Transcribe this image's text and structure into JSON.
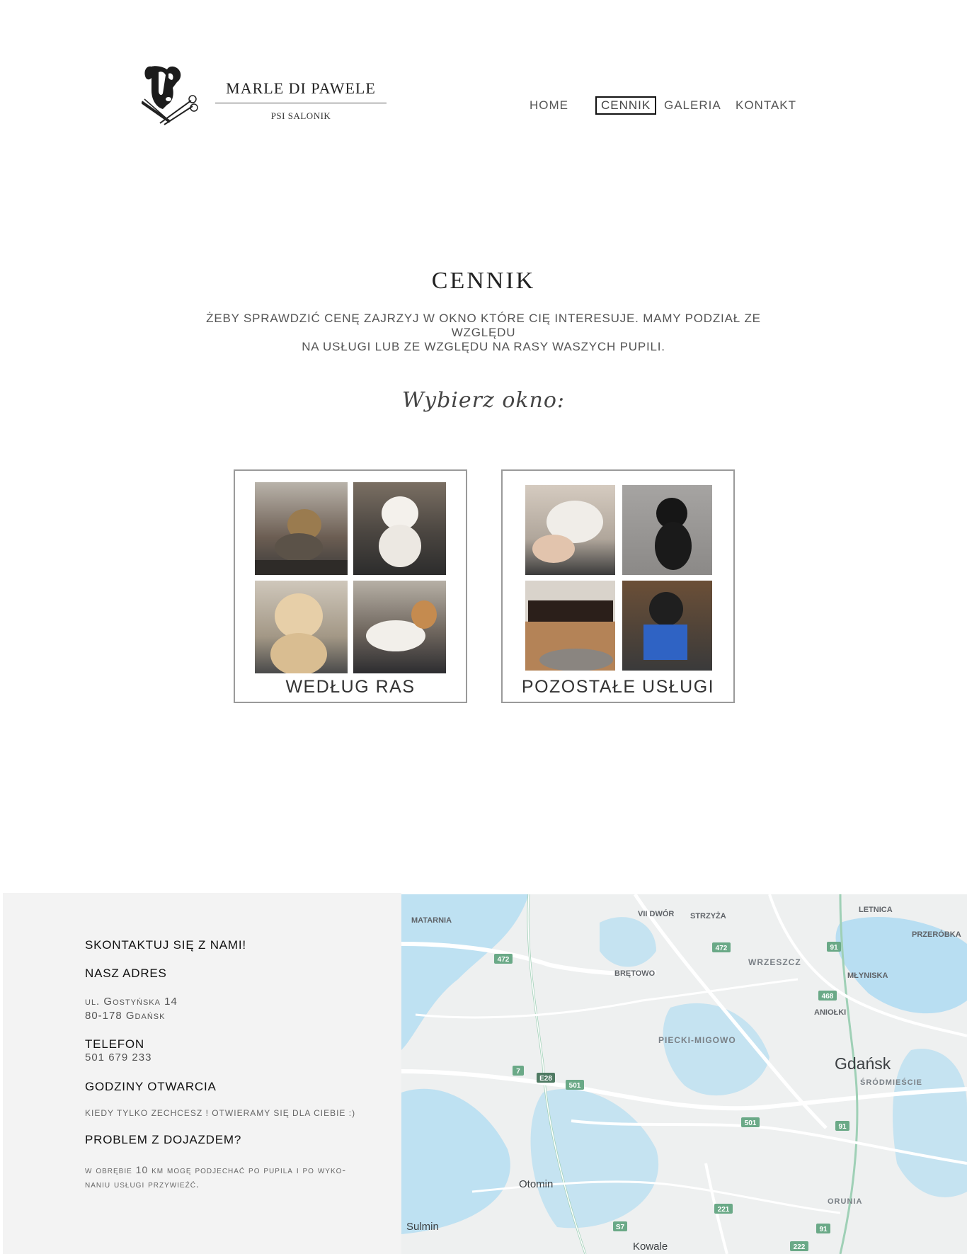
{
  "header": {
    "brand_title": "MARLE DI PAWELE",
    "brand_subtitle": "PSI SALONIK",
    "nav": [
      {
        "label": "HOME",
        "active": false
      },
      {
        "label": "CENNIK",
        "active": true
      },
      {
        "label": "GALERIA",
        "active": false
      },
      {
        "label": "KONTAKT",
        "active": false
      }
    ]
  },
  "main": {
    "title": "CENNIK",
    "intro_line1": "ŻEBY SPRAWDZIĆ CENĘ ZAJRZYJ W OKNO KTÓRE CIĘ INTERESUJE. MAMY PODZIAŁ ZE WZGLĘDU",
    "intro_line2": "NA USŁUGI LUB ZE WZGLĘDU NA RASY WASZYCH PUPILI.",
    "choose_label": "Wybierz okno:",
    "cards": [
      {
        "label": "WEDŁUG RAS"
      },
      {
        "label": "POZOSTAŁE USŁUGI"
      }
    ]
  },
  "footer": {
    "contact_heading": "SKONTAKTUJ SIĘ Z NAMI!",
    "address_heading": "NASZ ADRES",
    "address_line1": "ul. Gostyńska 14",
    "address_line2": "80-178 Gdańsk",
    "phone_heading": "TELEFON",
    "phone": "501 679 233",
    "hours_heading": "GODZINY OTWARCIA",
    "hours_text": "KIEDY TYLKO ZECHCESZ ! OTWIERAMY SIĘ DLA CIEBIE :)",
    "travel_heading": "PROBLEM Z DOJAZDEM?",
    "travel_line1": "w obrębie 10 km mogę podjechać po pupila i po wyko-",
    "travel_line2": "naniu usługi przywieźć."
  },
  "map": {
    "places": [
      "MATARNIA",
      "VII DWÓR",
      "STRZYŻA",
      "LETNICA",
      "PRZERÓBKA",
      "BRĘTOWO",
      "WRZESZCZ",
      "MŁYNISKA",
      "ANIOŁKI",
      "PIECKI-MIGOWO",
      "Gdańsk",
      "ŚRÓDMIEŚCIE",
      "Otomin",
      "ORUNIA",
      "Sulmin",
      "Kowale"
    ],
    "roads": [
      "472",
      "472",
      "91",
      "468",
      "7",
      "E28",
      "501",
      "501",
      "91",
      "221",
      "S7",
      "91",
      "222"
    ],
    "colors": {
      "land": "#eef0f0",
      "water": "#aadaf2",
      "road": "#ffffff",
      "road_label": "#6aa987"
    }
  }
}
